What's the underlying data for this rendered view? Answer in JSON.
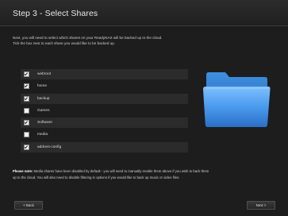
{
  "header": {
    "title": "Step 3 - Select Shares"
  },
  "intro": {
    "line1": "Next, you will need to select which shares on your ReadyNAS will be backed up to the cloud.",
    "line2": "Tick the box next to each share you would like to be backed up."
  },
  "shares": [
    {
      "label": "webroot",
      "checked": true
    },
    {
      "label": "home",
      "checked": true
    },
    {
      "label": "backup",
      "checked": true
    },
    {
      "label": "Games",
      "checked": false
    },
    {
      "label": "Software",
      "checked": true
    },
    {
      "label": "media",
      "checked": false
    },
    {
      "label": "addons-config",
      "checked": true
    }
  ],
  "folder": {
    "icon": "folder-icon",
    "color": "#3a8ee6"
  },
  "note": {
    "bold": "Please note:",
    "line1": "Media shares have been disabled by default - you will need to manually enable them above if you wish to back them",
    "line2": "up to the cloud. You will also need to disable filtering in options if you would like to back up music or video files."
  },
  "buttons": {
    "back": "<  Back",
    "next": "Next  >"
  }
}
